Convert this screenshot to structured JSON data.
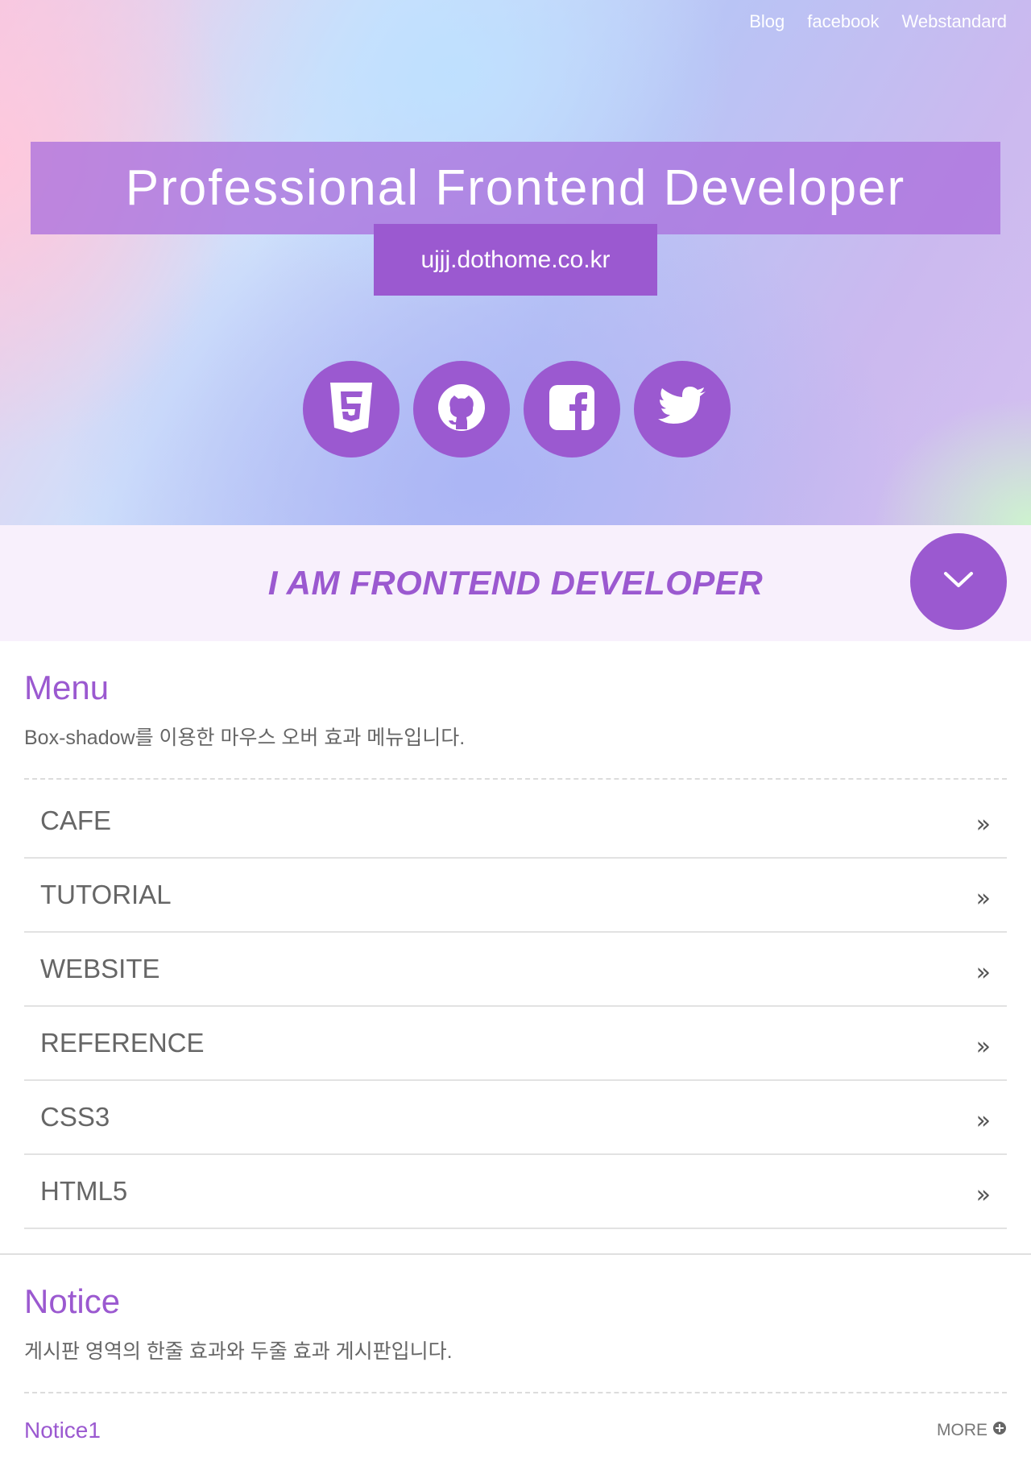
{
  "top_links": [
    "Blog",
    "facebook",
    "Webstandard"
  ],
  "hero": {
    "title": "Professional Frontend Developer",
    "subtitle": "ujjj.dothome.co.kr"
  },
  "social_icons": [
    "html5-icon",
    "github-icon",
    "facebook-icon",
    "twitter-icon"
  ],
  "intro": {
    "text": "I AM FRONTEND DEVELOPER"
  },
  "menu": {
    "title": "Menu",
    "description": "Box-shadow를 이용한 마우스 오버 효과 메뉴입니다.",
    "items": [
      "CAFE",
      "TUTORIAL",
      "WEBSITE",
      "REFERENCE",
      "CSS3",
      "HTML5"
    ],
    "arrow": "»"
  },
  "notice": {
    "title": "Notice",
    "description": "게시판 영역의 한줄 효과와 두줄 효과 게시판입니다.",
    "first_item": "Notice1",
    "more_label": "MORE"
  },
  "colors": {
    "accent": "#9b59d0",
    "intro_bg": "#f8f0fc"
  }
}
